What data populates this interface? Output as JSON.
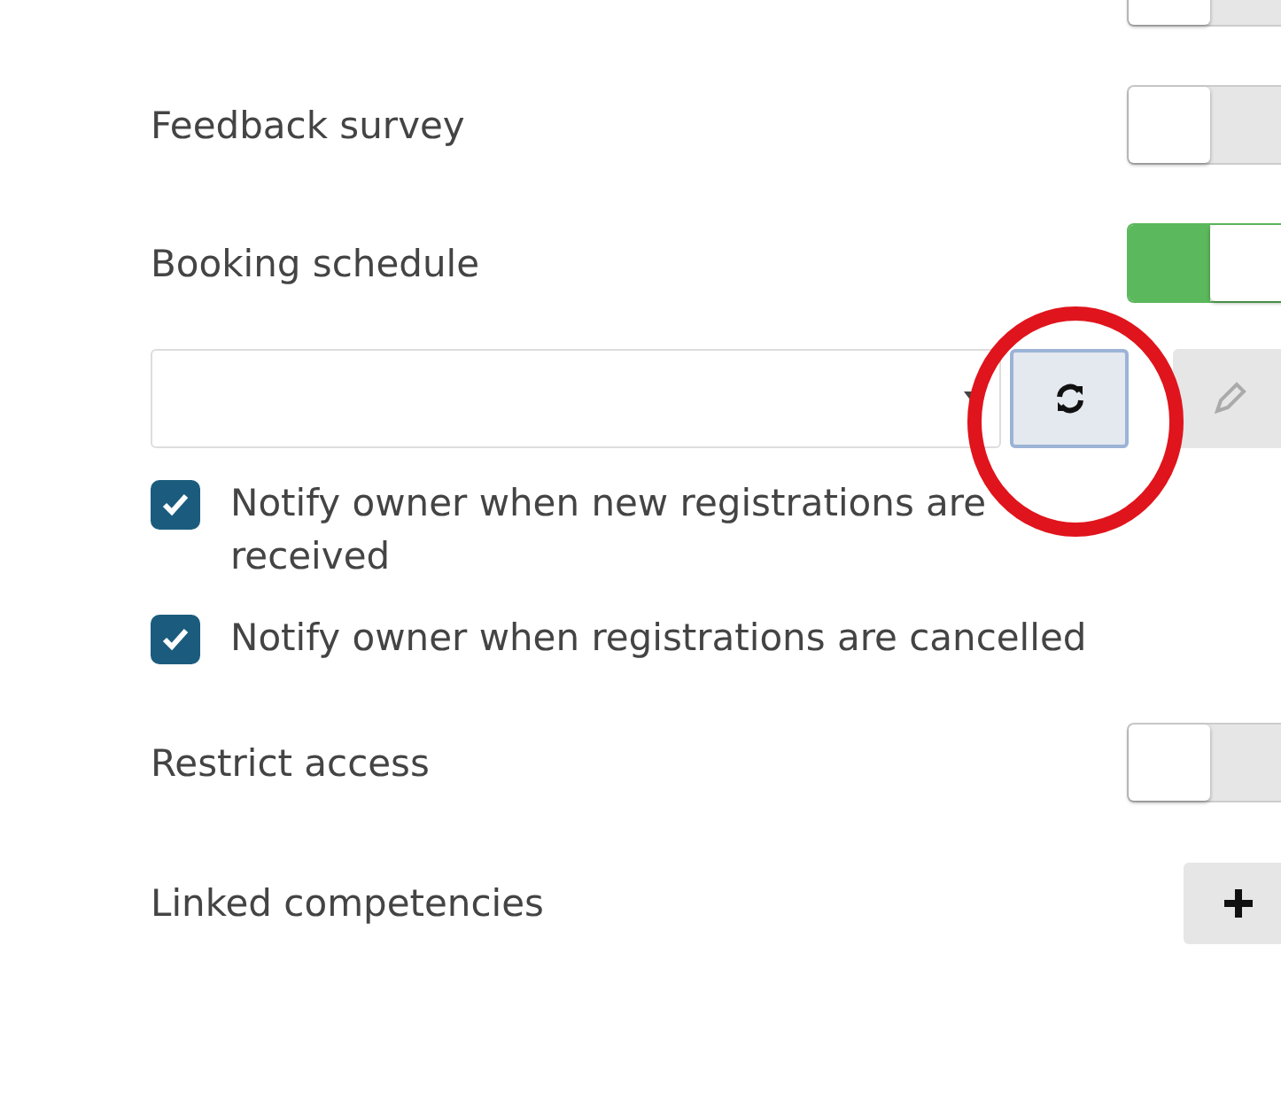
{
  "settings": [
    {
      "kind": "toggle",
      "on": false
    },
    {
      "kind": "toggle",
      "label": "Feedback survey",
      "on": false
    },
    {
      "kind": "toggle",
      "label": "Booking schedule",
      "on": true
    },
    {
      "kind": "select"
    },
    {
      "kind": "checkbox",
      "label": "Notify owner when new registrations are received",
      "checked": true
    },
    {
      "kind": "checkbox",
      "label": "Notify owner when registrations are cancelled",
      "checked": true
    },
    {
      "kind": "toggle",
      "label": "Restrict access",
      "on": false
    },
    {
      "kind": "add",
      "label": "Linked competencies"
    }
  ]
}
